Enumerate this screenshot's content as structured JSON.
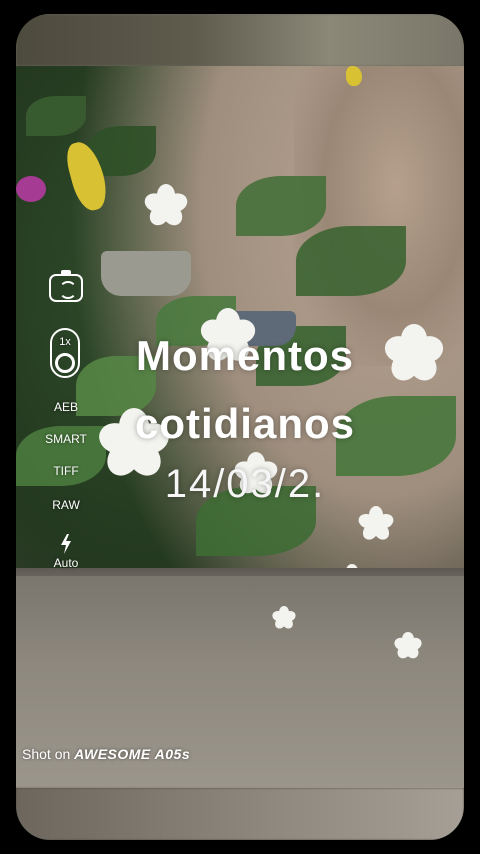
{
  "camera": {
    "zoom_label": "1x",
    "modes": [
      "AEB",
      "SMART",
      "TIFF",
      "RAW"
    ],
    "flash_label": "Auto"
  },
  "overlay": {
    "title_line1": "Momentos",
    "title_line2": "cotidianos",
    "date": "14/03/2."
  },
  "watermark": {
    "prefix": "Shot on ",
    "brand": "AWESOME A05s"
  },
  "icons": [
    "camera-switch-icon",
    "zoom-icon",
    "flash-icon"
  ],
  "colors": {
    "overlay_text": "#ffffff",
    "background": "#000000"
  }
}
